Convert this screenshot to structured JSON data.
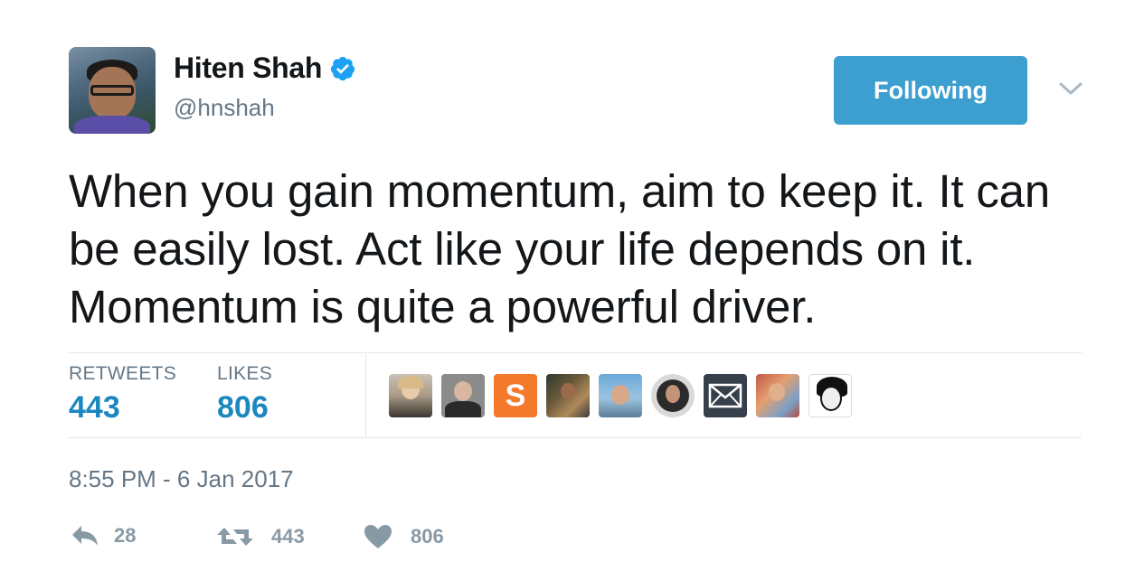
{
  "author": {
    "name": "Hiten Shah",
    "handle": "@hnshah",
    "verified": true,
    "avatar_icon": "profile-photo"
  },
  "follow_button": {
    "label": "Following",
    "color": "#3c9fd0"
  },
  "menu_icon": "chevron-down-icon",
  "tweet": {
    "text": "When you gain momentum, aim to keep it. It can be easily lost. Act like your life depends on it. Momentum is quite a powerful driver."
  },
  "stats": {
    "retweets_label": "RETWEETS",
    "retweets_value": "443",
    "likes_label": "LIKES",
    "likes_value": "806"
  },
  "likers": [
    {
      "icon": "liker-avatar-1"
    },
    {
      "icon": "liker-avatar-2"
    },
    {
      "icon": "liker-avatar-3",
      "text": "S"
    },
    {
      "icon": "liker-avatar-4"
    },
    {
      "icon": "liker-avatar-5"
    },
    {
      "icon": "liker-avatar-6"
    },
    {
      "icon": "envelope-icon"
    },
    {
      "icon": "liker-avatar-8"
    },
    {
      "icon": "liker-avatar-9"
    }
  ],
  "timestamp": "8:55 PM - 6 Jan 2017",
  "actions": {
    "reply_count": "28",
    "retweet_count": "443",
    "like_count": "806"
  },
  "colors": {
    "accent": "#1b87bf",
    "muted": "#657786",
    "action_gray": "#8899a6",
    "verified_blue": "#1da1f2"
  }
}
